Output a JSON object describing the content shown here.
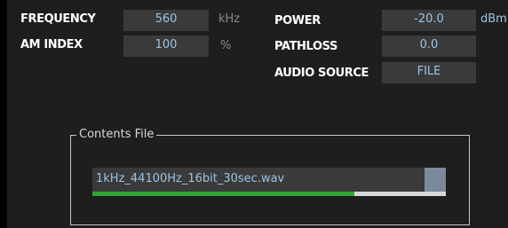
{
  "left_params": [
    {
      "label": "FREQUENCY",
      "value": "560",
      "unit": "kHz"
    },
    {
      "label": "AM INDEX",
      "value": "100",
      "unit": "%"
    }
  ],
  "right_params": [
    {
      "label": "POWER",
      "value": "-20.0",
      "unit": "dBm"
    },
    {
      "label": "PATHLOSS",
      "value": "0.0",
      "unit": ""
    },
    {
      "label": "AUDIO SOURCE",
      "value": "FILE",
      "unit": ""
    }
  ],
  "contents_file": {
    "title": "Contents File",
    "filename": "1kHz_44100Hz_16bit_30sec.wav",
    "progress_fraction": 0.74
  },
  "colors": {
    "panel_bg": "#1e1e1e",
    "field_bg": "#3a3a3a",
    "value_text": "#9cc4e4",
    "progress_fill": "#2fa636",
    "progress_track": "#d8d8d8"
  }
}
